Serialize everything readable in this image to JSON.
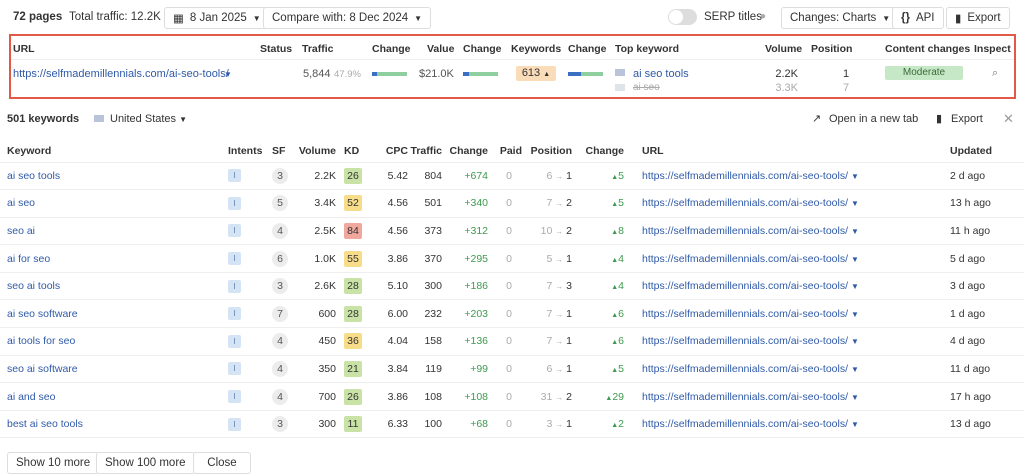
{
  "toolbar": {
    "pages": "72 pages",
    "total_traffic": "Total traffic: 12.2K",
    "date": "8 Jan 2025",
    "compare": "Compare with: 8 Dec 2024",
    "serp_titles": "SERP titles",
    "serp_titles_on": false,
    "changes": "Changes:  Charts",
    "api": "API",
    "export": "Export"
  },
  "pages_table": {
    "headers": [
      "URL",
      "Status",
      "Traffic",
      "Change",
      "Value",
      "Change",
      "Keywords",
      "Change",
      "Top keyword",
      "Volume",
      "Position",
      "Content changes",
      "Inspect"
    ],
    "row": {
      "url": "https://selfmademillennials.com/ai-seo-tools/",
      "traffic": "5,844",
      "traffic_pct": "47.9%",
      "value": "$21.0K",
      "keywords": "613",
      "top_keyword": "ai seo tools",
      "top_keyword_2": "ai seo",
      "volume": "2.2K",
      "volume_2": "3.3K",
      "position": "1",
      "position_2": "7",
      "content_changes": "Moderate"
    }
  },
  "keywords_panel": {
    "count": "501 keywords",
    "country": "United States",
    "open_new_tab": "Open in a new tab",
    "export": "Export",
    "headers": [
      "Keyword",
      "Intents",
      "SF",
      "Volume",
      "KD",
      "CPC",
      "Traffic",
      "Change",
      "Paid",
      "Position",
      "Change",
      "URL",
      "Updated"
    ],
    "rows": [
      {
        "keyword": "ai seo tools",
        "intent": "I",
        "sf": "3",
        "volume": "2.2K",
        "kd": "26",
        "cpc": "5.42",
        "traffic": "804",
        "change": "+674",
        "paid": "0",
        "pos_from": "6",
        "pos_to": "1",
        "pos_change": "5",
        "url": "https://selfmademillennials.com/ai-seo-tools/",
        "updated": "2 d ago"
      },
      {
        "keyword": "ai seo",
        "intent": "I",
        "sf": "5",
        "volume": "3.4K",
        "kd": "52",
        "cpc": "4.56",
        "traffic": "501",
        "change": "+340",
        "paid": "0",
        "pos_from": "7",
        "pos_to": "2",
        "pos_change": "5",
        "url": "https://selfmademillennials.com/ai-seo-tools/",
        "updated": "13 h ago"
      },
      {
        "keyword": "seo ai",
        "intent": "I",
        "sf": "4",
        "volume": "2.5K",
        "kd": "84",
        "cpc": "4.56",
        "traffic": "373",
        "change": "+312",
        "paid": "0",
        "pos_from": "10",
        "pos_to": "2",
        "pos_change": "8",
        "url": "https://selfmademillennials.com/ai-seo-tools/",
        "updated": "11 h ago"
      },
      {
        "keyword": "ai for seo",
        "intent": "I",
        "sf": "6",
        "volume": "1.0K",
        "kd": "55",
        "cpc": "3.86",
        "traffic": "370",
        "change": "+295",
        "paid": "0",
        "pos_from": "5",
        "pos_to": "1",
        "pos_change": "4",
        "url": "https://selfmademillennials.com/ai-seo-tools/",
        "updated": "5 d ago"
      },
      {
        "keyword": "seo ai tools",
        "intent": "I",
        "sf": "3",
        "volume": "2.6K",
        "kd": "28",
        "cpc": "5.10",
        "traffic": "300",
        "change": "+186",
        "paid": "0",
        "pos_from": "7",
        "pos_to": "3",
        "pos_change": "4",
        "url": "https://selfmademillennials.com/ai-seo-tools/",
        "updated": "3 d ago"
      },
      {
        "keyword": "ai seo software",
        "intent": "I",
        "sf": "7",
        "volume": "600",
        "kd": "28",
        "cpc": "6.00",
        "traffic": "232",
        "change": "+203",
        "paid": "0",
        "pos_from": "7",
        "pos_to": "1",
        "pos_change": "6",
        "url": "https://selfmademillennials.com/ai-seo-tools/",
        "updated": "1 d ago"
      },
      {
        "keyword": "ai tools for seo",
        "intent": "I",
        "sf": "4",
        "volume": "450",
        "kd": "36",
        "cpc": "4.04",
        "traffic": "158",
        "change": "+136",
        "paid": "0",
        "pos_from": "7",
        "pos_to": "1",
        "pos_change": "6",
        "url": "https://selfmademillennials.com/ai-seo-tools/",
        "updated": "4 d ago"
      },
      {
        "keyword": "seo ai software",
        "intent": "I",
        "sf": "4",
        "volume": "350",
        "kd": "21",
        "cpc": "3.84",
        "traffic": "119",
        "change": "+99",
        "paid": "0",
        "pos_from": "6",
        "pos_to": "1",
        "pos_change": "5",
        "url": "https://selfmademillennials.com/ai-seo-tools/",
        "updated": "11 d ago"
      },
      {
        "keyword": "ai and seo",
        "intent": "I",
        "sf": "4",
        "volume": "700",
        "kd": "26",
        "cpc": "3.86",
        "traffic": "108",
        "change": "+108",
        "paid": "0",
        "pos_from": "31",
        "pos_to": "2",
        "pos_change": "29",
        "url": "https://selfmademillennials.com/ai-seo-tools/",
        "updated": "17 h ago"
      },
      {
        "keyword": "best ai seo tools",
        "intent": "I",
        "sf": "3",
        "volume": "300",
        "kd": "11",
        "cpc": "6.33",
        "traffic": "100",
        "change": "+68",
        "paid": "0",
        "pos_from": "3",
        "pos_to": "1",
        "pos_change": "2",
        "url": "https://selfmademillennials.com/ai-seo-tools/",
        "updated": "13 d ago"
      }
    ],
    "show_10": "Show 10 more",
    "show_100": "Show 100 more",
    "close": "Close"
  },
  "colors": {
    "accent_link": "#2f5aa8",
    "highlight_border": "#e05a47",
    "kd_green": "#c9e3a6",
    "kd_yellow": "#f7dc8a",
    "kd_red": "#f0a79d",
    "moderate": "#c6e8c6",
    "keywords_badge": "#fbdcb8"
  }
}
